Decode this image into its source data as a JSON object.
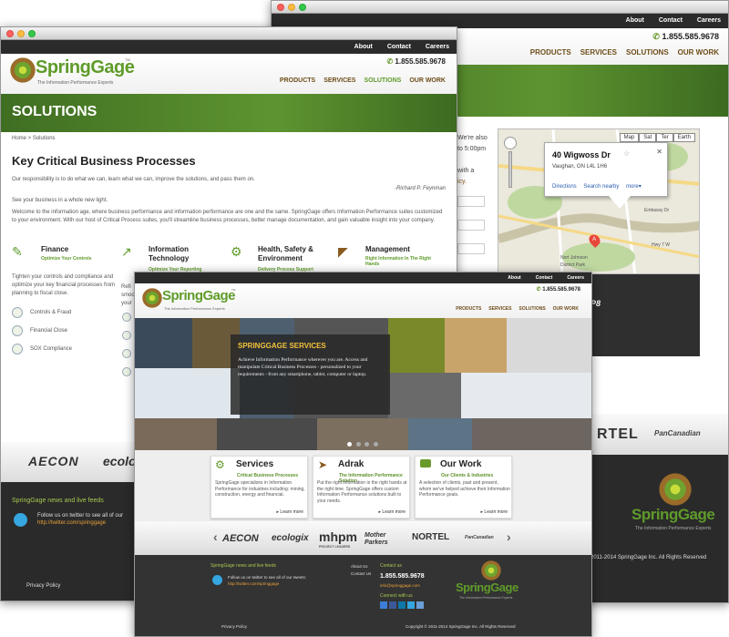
{
  "back": {
    "topnav": [
      "About",
      "Contact",
      "Careers"
    ],
    "phone": "1.855.585.9678",
    "nav": [
      "PRODUCTS",
      "SERVICES",
      "SOLUTIONS",
      "OUR WORK"
    ],
    "side_text": [
      "We're also",
      "to 5:00pm",
      "with a",
      "icy."
    ],
    "map": {
      "types": [
        "Map",
        "Sat",
        "Ter",
        "Earth"
      ],
      "popup_title": "40 Wigwoss Dr",
      "popup_address": "Vaughan, ON L4L 1H6",
      "popup_links": [
        "Directions",
        "Search nearby",
        "more▾"
      ],
      "marker": "A",
      "road_labels": [
        "Embassy Dr",
        "Hwy 7 W",
        "Nort Johnson",
        "District Park"
      ]
    },
    "partner_tail": [
      "RTEL",
      "PanCanadian"
    ],
    "side_p8": "P8",
    "footer_logo_name": "SpringGage",
    "footer_logo_tag": "The Information Performance Experts",
    "copyright": "2011-2014 SpringGage Inc. All Rights Reserved"
  },
  "mid": {
    "topnav": [
      "About",
      "Contact",
      "Careers"
    ],
    "phone": "1.855.585.9678",
    "logo_name": "SpringGage",
    "logo_tm": "TM",
    "logo_tag": "The Information Performance Experts",
    "nav": [
      "PRODUCTS",
      "SERVICES",
      "SOLUTIONS",
      "OUR WORK"
    ],
    "banner_title": "SOLUTIONS",
    "breadcrumb": "Home > Solutions",
    "heading": "Key Critical Business Processes",
    "intro": "Our responsibility is to do what we can, learn what we can, improve the solutions, and pass them on.",
    "quote_by": "-Richard P. Feynman",
    "tagline": "See your business in a whole new light.",
    "welcome": "Welcome to the information age, where business performance and information performance are one and the same. SpringGage offers Information Performance suites customized to your environment. With our host of Critical Process suites, you'll streamline business processes, better manage documentation, and gain valuable insight into your company.",
    "categories": [
      {
        "title": "Finance",
        "sub": "Optimize Your Controls"
      },
      {
        "title": "Information Technology",
        "sub": "Optimize Your Reporting"
      },
      {
        "title": "Health, Safety & Environment",
        "sub": "Delivery Process Support"
      },
      {
        "title": "Management",
        "sub": "Right Information In The Right Hands"
      }
    ],
    "finance_desc": "Tighten your controls and compliance and optimize your key financial processes from planning to fiscal close.",
    "finance_items": [
      "Controls & Fraud",
      "Financial Close",
      "SOX Compliance"
    ],
    "it_desc": [
      "Refi",
      "smoo",
      "your"
    ],
    "partners": [
      "AECON",
      "ecolo"
    ],
    "news_title": "SpringGage news and live feeds",
    "twitter_text": "Follow us on twitter to see all of our",
    "twitter_url": "http://twitter.com/springgage",
    "privacy": "Privacy Policy"
  },
  "front": {
    "topnav": [
      "About",
      "Contact",
      "Careers"
    ],
    "phone": "1.855.585.9678",
    "logo_name": "SpringGage",
    "logo_tm": "TM",
    "logo_tag": "The Information Performance Experts",
    "nav": [
      "PRODUCTS",
      "SERVICES",
      "SOLUTIONS",
      "OUR WORK"
    ],
    "hero_title": "SPRINGGAGE SERVICES",
    "hero_text": "Achieve Information Performance wherever you are. Access and manipulate Critical Business Processes - personalized to your requirements - from any smartphone, tablet, computer or laptop.",
    "cards": [
      {
        "title": "Services",
        "sub": "Critical Business Processes",
        "text": "SpringGage specializes in Information Performance for industries including: mining, construction, energy and financial.",
        "more": "▸ Learn more"
      },
      {
        "title": "Adrak",
        "sub": "The Information Performance Solution",
        "text": "Put the right information in the right hands at the right time. SpringGage offers custom Information Performance solutions built to your needs.",
        "more": "▸ Learn more"
      },
      {
        "title": "Our Work",
        "sub": "Our Clients & Industries",
        "text": "A selection of clients, past and present, whom we've helped achieve their Information Performance goals.",
        "more": "▸ Learn more"
      }
    ],
    "partners": [
      "AECON",
      "ecologix",
      "mhpm",
      "Mother Parkers",
      "NORTEL",
      "PanCanadian"
    ],
    "partner_arrows": [
      "‹",
      "›"
    ],
    "mhpm_tag": "PROJECT LEADERS",
    "news_title": "SpringGage news and live feeds",
    "twitter_text": "Follow us on twitter to see all of our tweets:",
    "twitter_url": "http://twitter.com/springgage",
    "footer_links": [
      "About Us",
      "Contact Us"
    ],
    "contact_label": "Contact us",
    "contact_phone": "1.855.585.9678",
    "contact_email": "info@springgage.com",
    "connect_label": "Connect with us",
    "footer_logo_name": "SpringGage",
    "footer_logo_tag": "The Information Performance Experts",
    "privacy": "Privacy Policy",
    "copyright": "Copyright © 2011-2014 SpringGage Inc. All Rights Reserved"
  },
  "colors": {
    "green": "#5f9b2a",
    "dark": "#2a2a2a",
    "brown": "#8a5a1e",
    "twitter": "#35a6e0"
  }
}
